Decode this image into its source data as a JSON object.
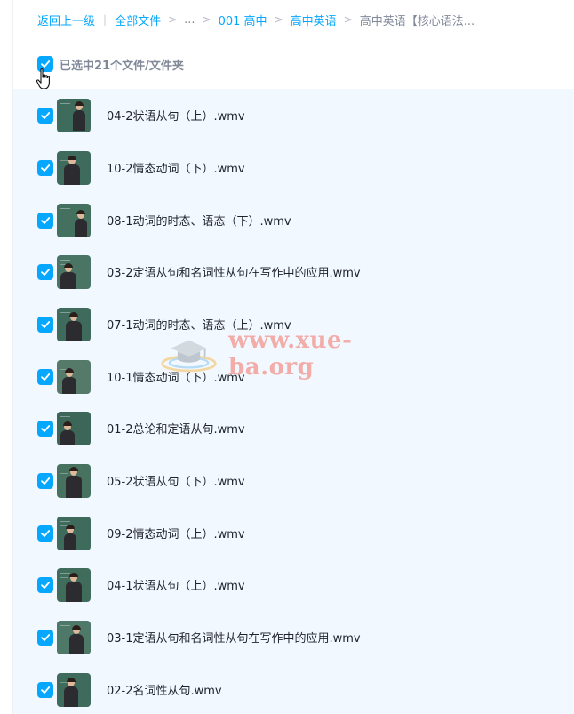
{
  "breadcrumb": {
    "back": "返回上一级",
    "items": [
      "全部文件",
      "...",
      "001 高中",
      "高中英语"
    ],
    "current": "高中英语【核心语法..."
  },
  "selection": {
    "label": "已选中21个文件/文件夹"
  },
  "files": [
    {
      "name": "04-2状语从句（上）.wmv"
    },
    {
      "name": "10-2情态动词（下）.wmv"
    },
    {
      "name": "08-1动词的时态、语态（下）.wmv"
    },
    {
      "name": "03-2定语从句和名词性从句在写作中的应用.wmv"
    },
    {
      "name": "07-1动词的时态、语态（上）.wmv"
    },
    {
      "name": "10-1情态动词（下）.wmv"
    },
    {
      "name": "01-2总论和定语从句.wmv"
    },
    {
      "name": "05-2状语从句（下）.wmv"
    },
    {
      "name": "09-2情态动词（上）.wmv"
    },
    {
      "name": "04-1状语从句（上）.wmv"
    },
    {
      "name": "03-1定语从句和名词性从句在写作中的应用.wmv"
    },
    {
      "name": "02-2名词性从句.wmv"
    }
  ],
  "watermark": {
    "text": "www.xue-ba.org"
  },
  "colors": {
    "accent": "#06a7ff",
    "list_bg": "#f2f8ff",
    "board": "#3f6b5c"
  }
}
